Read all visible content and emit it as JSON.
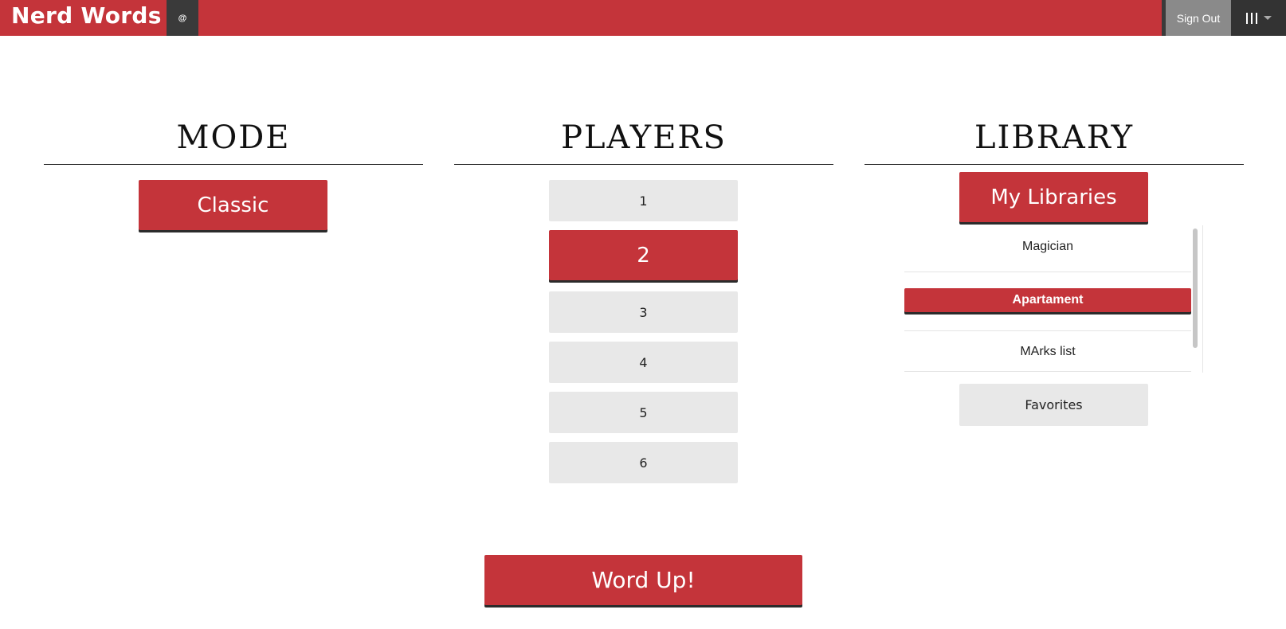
{
  "topbar": {
    "brand": "Nerd Words",
    "at_label": "@",
    "sign_out": "Sign Out",
    "menu_icon": "bars-icon"
  },
  "colors": {
    "accent": "#c4343a",
    "dark": "#333333",
    "grey_button": "#e8e8e8"
  },
  "mode": {
    "title": "MODE",
    "options": [
      {
        "label": "Classic",
        "selected": true
      }
    ]
  },
  "players": {
    "title": "PLAYERS",
    "options": [
      {
        "label": "1",
        "selected": false
      },
      {
        "label": "2",
        "selected": true
      },
      {
        "label": "3",
        "selected": false
      },
      {
        "label": "4",
        "selected": false
      },
      {
        "label": "5",
        "selected": false
      },
      {
        "label": "6",
        "selected": false
      }
    ]
  },
  "library": {
    "title": "LIBRARY",
    "my_libraries": "My Libraries",
    "items": [
      {
        "label": "Magician",
        "selected": false
      },
      {
        "label": "Apartament",
        "selected": true
      },
      {
        "label": "MArks list",
        "selected": false
      }
    ],
    "favorites": "Favorites"
  },
  "submit": {
    "label": "Word Up!"
  }
}
